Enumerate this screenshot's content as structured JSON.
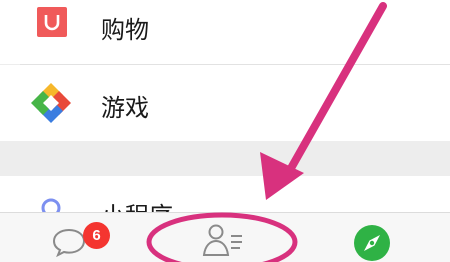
{
  "list": {
    "items": [
      {
        "label": "购物",
        "icon": "shopping-bag-icon",
        "color": "#f05a5a"
      },
      {
        "label": "游戏",
        "icon": "game-diamond-icon",
        "colors": [
          "#f6b72b",
          "#e84a3a",
          "#3b7de0",
          "#47b548"
        ]
      },
      {
        "label": "小程序",
        "icon": "mini-program-icon",
        "color": "#7d90f0"
      }
    ]
  },
  "tabbar": {
    "tabs": [
      {
        "name": "chats",
        "icon": "chat-bubble-icon",
        "badge": "6"
      },
      {
        "name": "contacts",
        "icon": "contacts-icon"
      },
      {
        "name": "discover",
        "icon": "compass-icon",
        "color": "#2fb245"
      }
    ]
  },
  "annotation": {
    "color": "#d8317e",
    "type": "arrow-and-circle"
  }
}
